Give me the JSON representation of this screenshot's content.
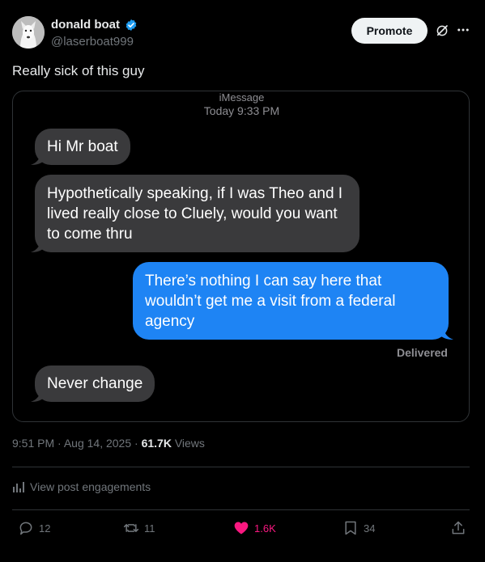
{
  "author": {
    "display_name": "donald boat",
    "handle": "@laserboat999"
  },
  "header": {
    "promote_label": "Promote"
  },
  "post": {
    "text": "Really sick of this guy"
  },
  "imessage": {
    "service": "iMessage",
    "timestamp": "Today 9:33 PM",
    "messages": [
      {
        "from": "them",
        "text": "Hi Mr boat"
      },
      {
        "from": "them",
        "text": "Hypothetically speaking, if I was Theo and I lived really close to Cluely, would you want to come thru"
      },
      {
        "from": "me",
        "text": "There’s nothing I can say here that wouldn’t get me a visit from a federal agency"
      },
      {
        "from": "them",
        "text": "Never change"
      }
    ],
    "delivered_label": "Delivered"
  },
  "meta": {
    "time": "9:51 PM",
    "date": "Aug 14, 2025",
    "views_count": "61.7K",
    "views_label": "Views"
  },
  "engagements_label": "View post engagements",
  "actions": {
    "replies": "12",
    "reposts": "11",
    "likes": "1.6K",
    "bookmarks": "34"
  },
  "colors": {
    "verified_blue": "#1d9bf0",
    "like_pink": "#f91880",
    "imessage_blue": "#1e84f4",
    "imessage_gray": "#3a3a3c"
  }
}
